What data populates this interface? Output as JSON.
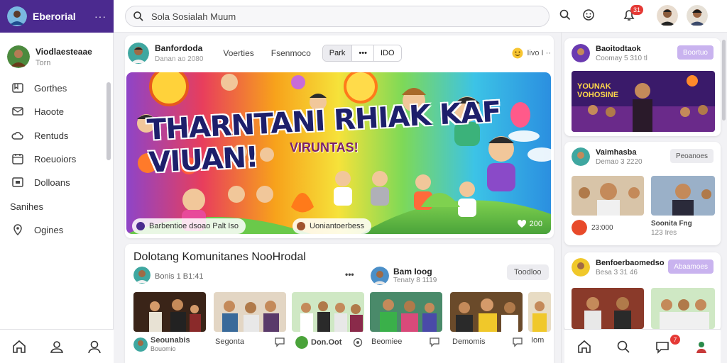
{
  "app": {
    "title": "Eberorial",
    "more": "···"
  },
  "search": {
    "placeholder": "Sola Sosialah Muum"
  },
  "topbar": {
    "notif_count": "31"
  },
  "profile": {
    "name": "Viodlaesteaae",
    "sub": "Torn"
  },
  "sidebar": {
    "items": [
      {
        "label": "Gorthes",
        "icon": "bookmark-icon"
      },
      {
        "label": "Haoote",
        "icon": "mail-icon"
      },
      {
        "label": "Rentuds",
        "icon": "cloud-icon"
      },
      {
        "label": "Roeuoiors",
        "icon": "calendar-icon"
      },
      {
        "label": "Dolloans",
        "icon": "grid-icon"
      }
    ],
    "section_label": "Sanihes",
    "extra_item": {
      "label": "Ogines",
      "icon": "location-icon"
    }
  },
  "post": {
    "author": "Banfordoda",
    "meta": "Danan ao 2080",
    "tab1": "Voerties",
    "tab2": "Fsenmoco",
    "seg": [
      "Park",
      "•••",
      "IDO"
    ],
    "reaction": "Iivo I ··"
  },
  "banner": {
    "title": "THARNTANI RHIAK KAF VIUAN!",
    "subtitle": "VIRUNTAS!",
    "chip1": "Barbentioe dsoao   Palt Iso",
    "chip2": "Uoniantoerbess",
    "likes": "200"
  },
  "community": {
    "title": "Dolotang  Komunitanes NooHrodal",
    "creator": "Bonis 1 B1:41",
    "more": "•••",
    "user2": "Bam Ioog",
    "user2_meta": "Tenaty 8 1119",
    "follow": "Toodloo",
    "captions": [
      {
        "name": "Seounabis",
        "sub": "Bouomio"
      },
      {
        "name": "Segonta",
        "sub": ""
      },
      {
        "name": "Don.Oot",
        "sub": ""
      },
      {
        "name": "Beomiee",
        "sub": ""
      },
      {
        "name": "Demomis",
        "sub": ""
      },
      {
        "name": "Iom",
        "sub": ""
      }
    ]
  },
  "right_cards": [
    {
      "name": "Baoitodtaok",
      "sub": "Coomay 5 310 tl",
      "button": "Boortuo",
      "banner_text": "YOUNAK VOHOSINE"
    },
    {
      "name": "Vaimhasba",
      "sub": "Demao 3 2220",
      "button": "Peoanoes",
      "cap1": "23:000",
      "cap2": "Soonita Fng",
      "cap2_sub": "123 Ires"
    },
    {
      "name": "Benfoerbaomedso",
      "sub": "Besa 3 31 46",
      "button": "Abaamoes"
    }
  ],
  "colors": {
    "brand": "#4b2a8f",
    "accent": "#b99ce6",
    "badge": "#e53935"
  }
}
